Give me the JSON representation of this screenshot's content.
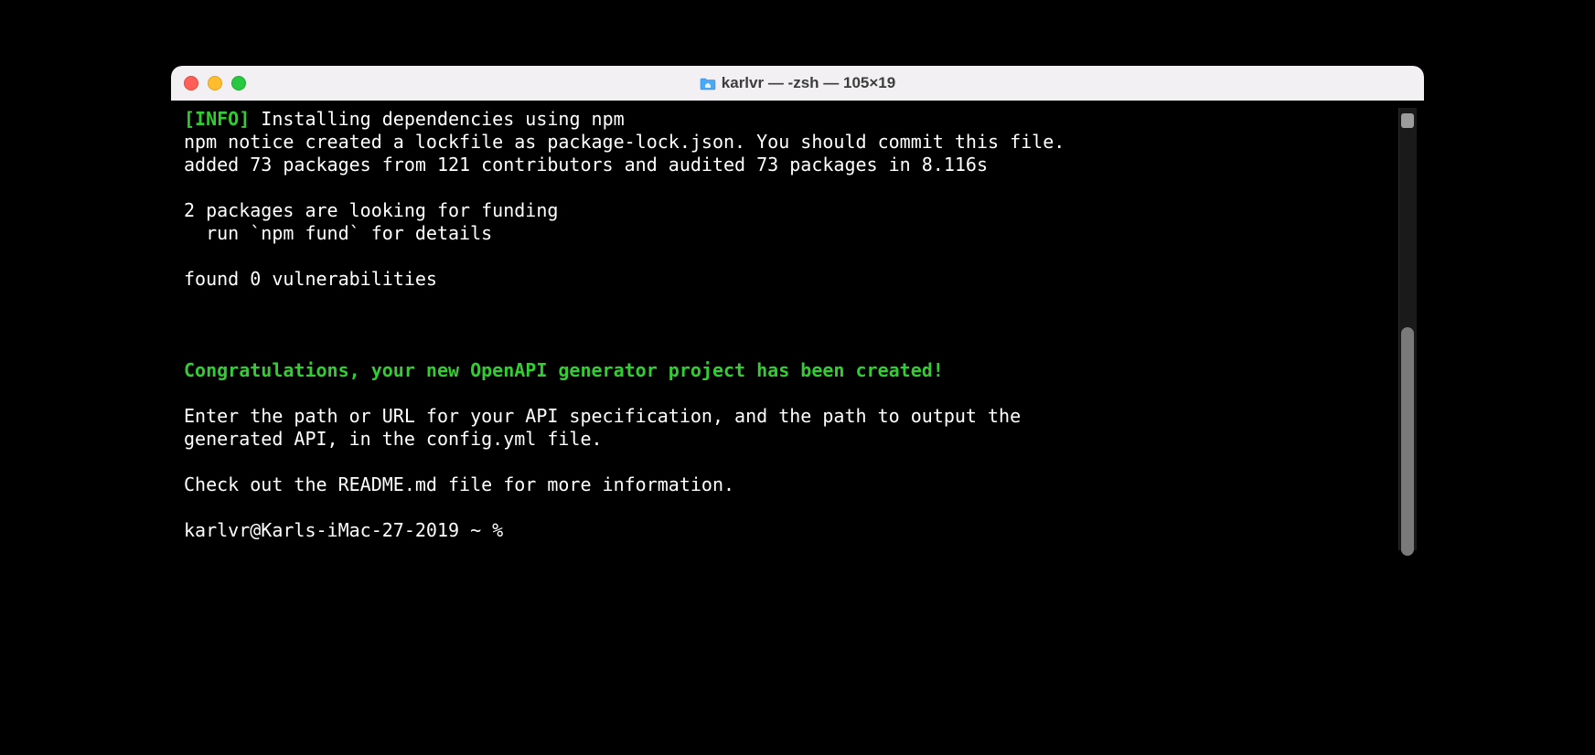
{
  "window": {
    "title": "karlvr — -zsh — 105×19"
  },
  "terminal": {
    "lines": [
      {
        "segments": [
          {
            "text": "[INFO]",
            "cls": "info-tag"
          },
          {
            "text": " Installing dependencies using npm",
            "cls": ""
          }
        ]
      },
      {
        "segments": [
          {
            "text": "npm notice created a lockfile as package-lock.json. You should commit this file.",
            "cls": ""
          }
        ]
      },
      {
        "segments": [
          {
            "text": "added 73 packages from 121 contributors and audited 73 packages in 8.116s",
            "cls": ""
          }
        ]
      },
      {
        "segments": [
          {
            "text": " ",
            "cls": ""
          }
        ]
      },
      {
        "segments": [
          {
            "text": "2 packages are looking for funding",
            "cls": ""
          }
        ]
      },
      {
        "segments": [
          {
            "text": "  run `npm fund` for details",
            "cls": ""
          }
        ]
      },
      {
        "segments": [
          {
            "text": " ",
            "cls": ""
          }
        ]
      },
      {
        "segments": [
          {
            "text": "found 0 vulnerabilities",
            "cls": ""
          }
        ]
      },
      {
        "segments": [
          {
            "text": " ",
            "cls": ""
          }
        ]
      },
      {
        "segments": [
          {
            "text": " ",
            "cls": ""
          }
        ]
      },
      {
        "segments": [
          {
            "text": " ",
            "cls": ""
          }
        ]
      },
      {
        "segments": [
          {
            "text": "Congratulations, your new OpenAPI generator project has been created!",
            "cls": "green-bold"
          }
        ]
      },
      {
        "segments": [
          {
            "text": " ",
            "cls": ""
          }
        ]
      },
      {
        "segments": [
          {
            "text": "Enter the path or URL for your API specification, and the path to output the",
            "cls": ""
          }
        ]
      },
      {
        "segments": [
          {
            "text": "generated API, in the config.yml file.",
            "cls": ""
          }
        ]
      },
      {
        "segments": [
          {
            "text": " ",
            "cls": ""
          }
        ]
      },
      {
        "segments": [
          {
            "text": "Check out the README.md file for more information.",
            "cls": ""
          }
        ]
      },
      {
        "segments": [
          {
            "text": " ",
            "cls": ""
          }
        ]
      },
      {
        "segments": [
          {
            "text": "karlvr@Karls-iMac-27-2019 ~ % ",
            "cls": ""
          }
        ]
      }
    ]
  }
}
